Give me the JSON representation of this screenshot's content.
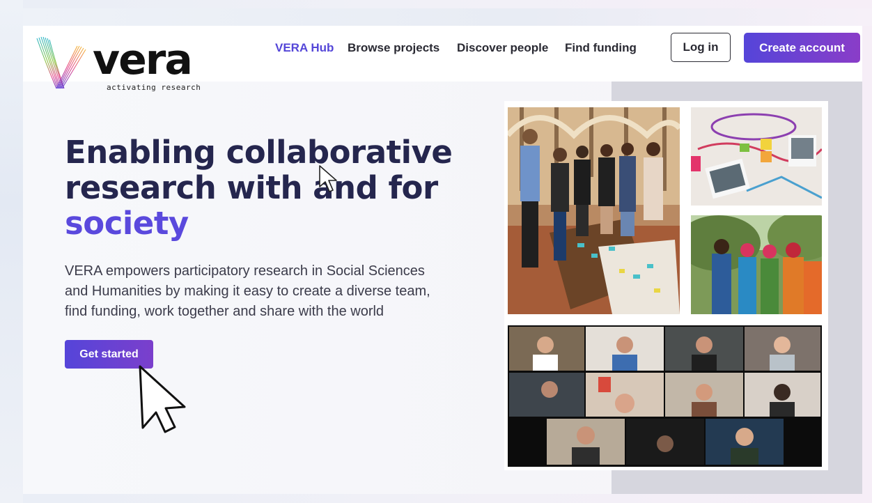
{
  "brand": {
    "name": "vera",
    "tagline": "activating research"
  },
  "nav": {
    "items": [
      "VERA Hub",
      "Browse projects",
      "Discover people",
      "Find funding"
    ],
    "login_label": "Log in",
    "create_account_label": "Create account"
  },
  "hero": {
    "title_line1": "Enabling collaborative",
    "title_line2": "research with and for",
    "title_line3": "society",
    "description_lines": [
      "VERA empowers participatory research in Social Sciences",
      "and Humanities by making it easy to create a diverse team,",
      "find funding, work together and share with the world"
    ],
    "cta_label": "Get started"
  },
  "colors": {
    "accent": "#5a49dd",
    "accent_gradient_end": "#8a3dc8",
    "title": "#25264e",
    "body_text": "#3b3b4a"
  },
  "icons": {
    "logo_mark": "vera-v-logo-icon",
    "pointer_large": "mouse-pointer-icon",
    "pointer_small": "mouse-pointer-icon"
  }
}
